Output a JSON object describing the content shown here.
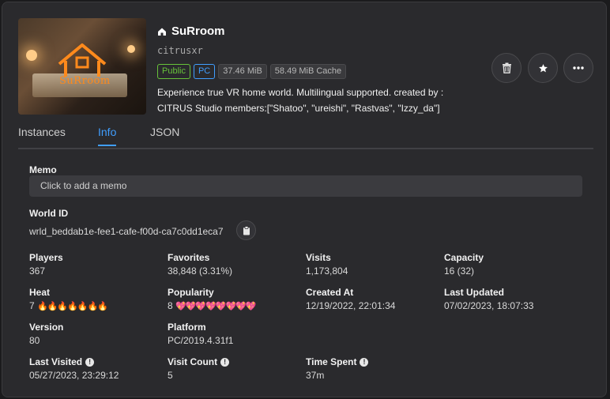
{
  "world": {
    "name": "SuRroom",
    "author": "citrusxr",
    "thumbnail_text": "SuRroom",
    "tags": [
      "Public",
      "PC",
      "37.46 MiB",
      "58.49 MiB Cache"
    ],
    "description_line1": "Experience true VR home world. Multilingual supported. created by :",
    "description_line2": "CITRUS Studio members:[\"Shatoo\", \"ureishi\", \"Rastvas\", \"Izzy_da\"]"
  },
  "actions": [
    "trash-icon",
    "star-icon",
    "more-icon"
  ],
  "tabs": [
    "Instances",
    "Info",
    "JSON"
  ],
  "active_tab": "Info",
  "info": {
    "memo_label": "Memo",
    "memo_placeholder": "Click to add a memo",
    "world_id_label": "World ID",
    "world_id": "wrld_beddab1e-fee1-cafe-f00d-ca7c0dd1eca7",
    "players_label": "Players",
    "players": "367",
    "favorites_label": "Favorites",
    "favorites": "38,848 (3.31%)",
    "visits_label": "Visits",
    "visits": "1,173,804",
    "capacity_label": "Capacity",
    "capacity": "16 (32)",
    "heat_label": "Heat",
    "heat": "7",
    "heat_icons": "🔥🔥🔥🔥🔥🔥🔥",
    "popularity_label": "Popularity",
    "popularity": "8",
    "popularity_icons": "💖💖💖💖💖💖💖💖",
    "created_label": "Created At",
    "created": "12/19/2022, 22:01:34",
    "updated_label": "Last Updated",
    "updated": "07/02/2023, 18:07:33",
    "version_label": "Version",
    "version": "80",
    "platform_label": "Platform",
    "platform": "PC/2019.4.31f1",
    "last_visited_label": "Last Visited",
    "last_visited": "05/27/2023, 23:29:12",
    "visit_count_label": "Visit Count",
    "visit_count": "5",
    "time_spent_label": "Time Spent",
    "time_spent": "37m"
  },
  "colors": {
    "accent": "#409eff",
    "public": "#67c23a",
    "background": "#2a2a2d"
  }
}
